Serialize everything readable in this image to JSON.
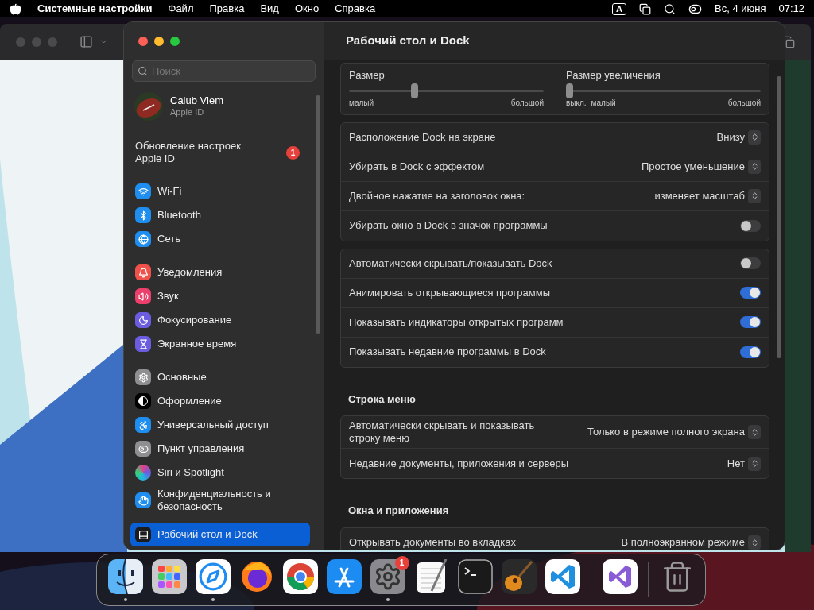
{
  "menu_bar": {
    "app_name": "Системные настройки",
    "menus": [
      "Файл",
      "Правка",
      "Вид",
      "Окно",
      "Справка"
    ],
    "input_source": "A",
    "date": "Вс, 4 июня",
    "time": "07:12"
  },
  "settings_window": {
    "title": "Рабочий стол и Dock",
    "search": {
      "placeholder": "Поиск"
    },
    "account": {
      "name": "Calub Viem",
      "subtitle": "Apple ID"
    },
    "notice": {
      "text": "Обновление настроек Apple ID",
      "badge": "1"
    },
    "sidebar": {
      "groups": [
        [
          {
            "label": "Wi-Fi",
            "selected": false
          },
          {
            "label": "Bluetooth",
            "selected": false
          },
          {
            "label": "Сеть",
            "selected": false
          }
        ],
        [
          {
            "label": "Уведомления",
            "selected": false
          },
          {
            "label": "Звук",
            "selected": false
          },
          {
            "label": "Фокусирование",
            "selected": false
          },
          {
            "label": "Экранное время",
            "selected": false
          }
        ],
        [
          {
            "label": "Основные",
            "selected": false
          },
          {
            "label": "Оформление",
            "selected": false
          },
          {
            "label": "Универсальный доступ",
            "selected": false
          },
          {
            "label": "Пункт управления",
            "selected": false
          },
          {
            "label": "Siri и Spotlight",
            "selected": false
          },
          {
            "label": "Конфиденциальность и безопасность",
            "selected": false
          },
          {
            "label": "Рабочий стол и Dock",
            "selected": true
          }
        ]
      ]
    },
    "content": {
      "sliders": [
        {
          "label": "Размер",
          "level": 0.33,
          "ticks": [
            "малый",
            "большой"
          ]
        },
        {
          "label": "Размер увеличения",
          "level": 0,
          "ticks": [
            "выкл.",
            "малый",
            "большой"
          ]
        }
      ],
      "sections": [
        {
          "rows": [
            {
              "kind": "select",
              "label": "Расположение Dock на экране",
              "value": "Внизу"
            },
            {
              "kind": "select",
              "label": "Убирать в Dock с эффектом",
              "value": "Простое уменьшение"
            },
            {
              "kind": "select",
              "label": "Двойное нажатие на заголовок окна:",
              "value": "изменяет масштаб"
            },
            {
              "kind": "toggle",
              "label": "Убирать окно в Dock в значок программы",
              "on": false
            }
          ]
        },
        {
          "rows": [
            {
              "kind": "toggle",
              "label": "Автоматически скрывать/показывать Dock",
              "on": false
            },
            {
              "kind": "toggle",
              "label": "Анимировать открывающиеся программы",
              "on": true
            },
            {
              "kind": "toggle",
              "label": "Показывать индикаторы открытых программ",
              "on": true
            },
            {
              "kind": "toggle",
              "label": "Показывать недавние программы в Dock",
              "on": true
            }
          ]
        },
        {
          "title": "Строка меню",
          "rows": [
            {
              "kind": "select",
              "label": "Автоматически скрывать и показывать строку меню",
              "value": "Только в режиме полного экрана"
            },
            {
              "kind": "select",
              "label": "Недавние документы, приложения и серверы",
              "value": "Нет"
            }
          ]
        },
        {
          "title": "Окна и приложения",
          "rows": [
            {
              "kind": "select",
              "label": "Открывать документы во вкладках",
              "value": "В полноэкранном режиме"
            }
          ]
        }
      ]
    }
  },
  "dock": {
    "groups": [
      [
        {
          "running": true
        },
        {
          "running": false
        },
        {
          "running": true
        },
        {
          "running": false
        },
        {
          "running": false
        },
        {
          "running": false
        },
        {
          "running": true,
          "badge": "1"
        },
        {
          "running": false
        },
        {
          "running": false
        },
        {
          "running": false
        },
        {
          "running": false
        }
      ],
      [
        {
          "running": false
        }
      ],
      [
        {
          "running": false
        }
      ]
    ]
  }
}
